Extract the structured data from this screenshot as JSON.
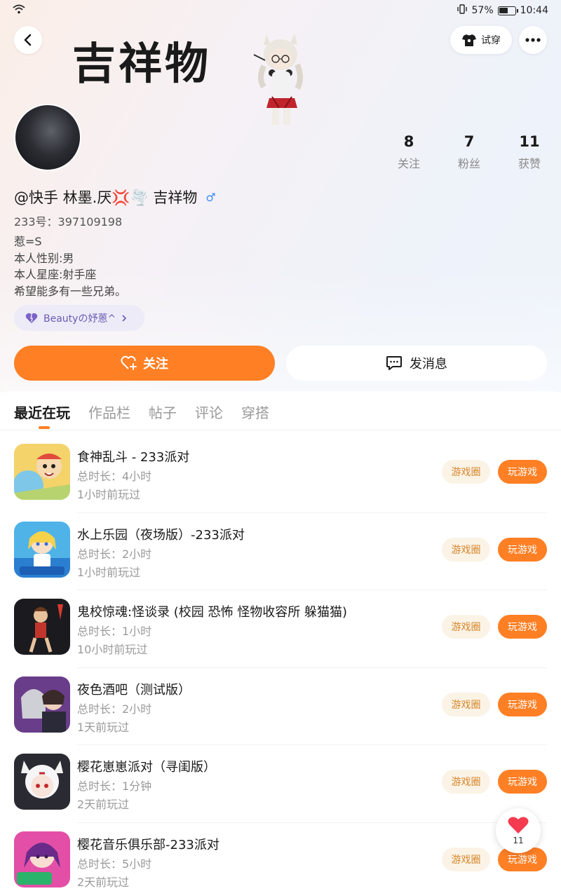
{
  "status_bar": {
    "battery_pct": "57%",
    "time": "10:44"
  },
  "header": {
    "title_banner": "吉祥物",
    "try_on_label": "试穿"
  },
  "profile": {
    "nickname": "@快手 林墨.厌💢🌪️ 吉祥物",
    "gender_symbol": "♂",
    "uid": "233号：397109198",
    "bio": [
      "惹=S",
      "本人性别:男",
      "本人星座:射手座",
      "希望能多有一些兄弟。"
    ],
    "tag": "Beautyの妤蒽^"
  },
  "stats": [
    {
      "value": "8",
      "label": "关注"
    },
    {
      "value": "7",
      "label": "粉丝"
    },
    {
      "value": "11",
      "label": "获赞"
    }
  ],
  "actions": {
    "follow": "关注",
    "message": "发消息"
  },
  "tabs": [
    "最近在玩",
    "作品栏",
    "帖子",
    "评论",
    "穿搭"
  ],
  "active_tab": "最近在玩",
  "games": [
    {
      "title": "食神乱斗 - 233派对",
      "duration": "总时长：4小时",
      "last_played": "1小时前玩过",
      "icon": "food-battle-icon"
    },
    {
      "title": "水上乐园（夜场版）-233派对",
      "duration": "总时长：2小时",
      "last_played": "1小时前玩过",
      "icon": "water-park-icon"
    },
    {
      "title": "鬼校惊魂:怪谈录 (校园 恐怖 怪物收容所 躲猫猫)",
      "duration": "总时长：1小时",
      "last_played": "10小时前玩过",
      "icon": "ghost-school-icon"
    },
    {
      "title": "夜色酒吧（测试版）",
      "duration": "总时长：2小时",
      "last_played": "1天前玩过",
      "icon": "night-bar-icon"
    },
    {
      "title": "樱花崽崽派对（寻闺版）",
      "duration": "总时长：1分钟",
      "last_played": "2天前玩过",
      "icon": "sakura-kids-icon"
    },
    {
      "title": "樱花音乐俱乐部-233派对",
      "duration": "总时长：5小时",
      "last_played": "2天前玩过",
      "icon": "sakura-music-icon"
    }
  ],
  "game_buttons": {
    "circle": "游戏圈",
    "play": "玩游戏"
  },
  "like_fab": {
    "count": "11"
  },
  "colors": {
    "accent": "#ff7f24",
    "circle_bg": "#fbf3e6",
    "circle_text": "#d6862a",
    "tag_text": "#6b5bb5"
  }
}
